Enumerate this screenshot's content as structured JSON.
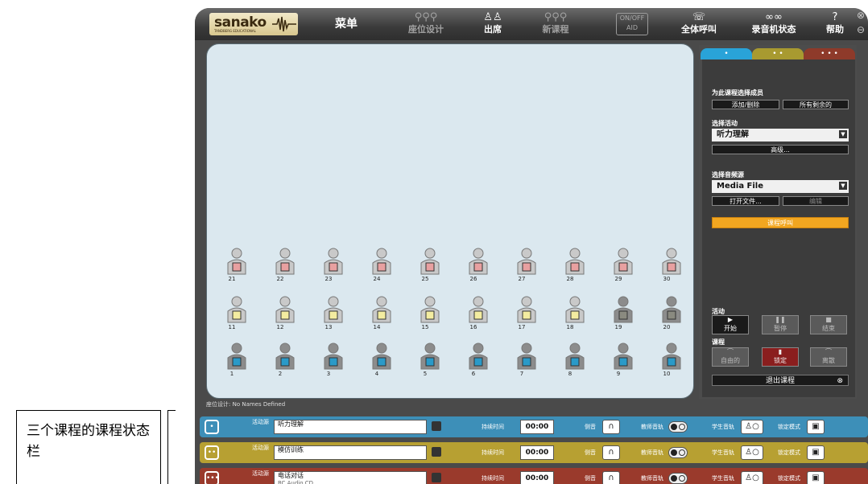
{
  "annotation": {
    "text": "三个课程的课程状态栏"
  },
  "app": {
    "logo": {
      "name": "sanako",
      "sub": "TANDBERG EDUCATIONAL"
    },
    "nav": {
      "menu": "菜单",
      "seat_design": "座位设计",
      "attendance": "出席",
      "new_lesson": "新课程",
      "onoff": "ON/OFF AID",
      "call_all": "全体呼叫",
      "recorder_status": "录音机状态",
      "help": "帮助"
    },
    "seats": {
      "row_top": {
        "numbers": [
          "21",
          "22",
          "23",
          "24",
          "25",
          "26",
          "27",
          "28",
          "29",
          "30"
        ],
        "color": "#e8a0a0"
      },
      "row_mid": {
        "numbers": [
          "11",
          "12",
          "13",
          "14",
          "15",
          "16",
          "17",
          "18",
          "19",
          "20"
        ],
        "color": "#f3eca0"
      },
      "row_bot": {
        "numbers": [
          "1",
          "2",
          "3",
          "4",
          "5",
          "6",
          "7",
          "8",
          "9",
          "10"
        ],
        "color": "#2a9ac8"
      }
    },
    "panel": {
      "tabs": [
        "•",
        "• •",
        "• • •"
      ],
      "select_members_label": "为此课程选择成员",
      "add_remove": "添加/删除",
      "all_remaining": "所有剩余的",
      "select_activity_label": "选择活动",
      "activity_value": "听力理解",
      "advanced": "高级...",
      "select_source_label": "选择音频源",
      "source_value": "Media File",
      "open_file": "打开文件...",
      "edit": "编辑",
      "lesson_call": "课程呼叫",
      "activity_section": "活动",
      "start": "开始",
      "pause": "暂停",
      "end": "结束",
      "lesson_section": "课程",
      "free": "自由的",
      "lock": "锁定",
      "release": "离散",
      "exit_lesson": "退出课程"
    },
    "seat_status": "座位设计:  No Names Defined",
    "lessons": [
      {
        "num": "•",
        "color": "#3d8fb8",
        "activity_label": "活动源",
        "name": "听力理解",
        "duration_label": "持续时间",
        "time": "00:00",
        "monitor_label": "侧音",
        "teacher_track": "教师音轨",
        "student_track": "学生音轨",
        "lock_mode": "锁定模式"
      },
      {
        "num": "••",
        "color": "#b7a032",
        "activity_label": "活动源",
        "name": "模仿训练",
        "duration_label": "持续时间",
        "time": "00:00",
        "monitor_label": "侧音",
        "teacher_track": "教师音轨",
        "student_track": "学生音轨",
        "lock_mode": "锁定模式"
      },
      {
        "num": "•••",
        "color": "#9a3a2c",
        "activity_label": "活动源",
        "name": "电话对话",
        "name_sub": "RC Audio CD",
        "duration_label": "持续时间",
        "time": "00:00",
        "monitor_label": "侧音",
        "teacher_track": "教师音轨",
        "student_track": "学生音轨",
        "lock_mode": "锁定模式"
      }
    ]
  }
}
